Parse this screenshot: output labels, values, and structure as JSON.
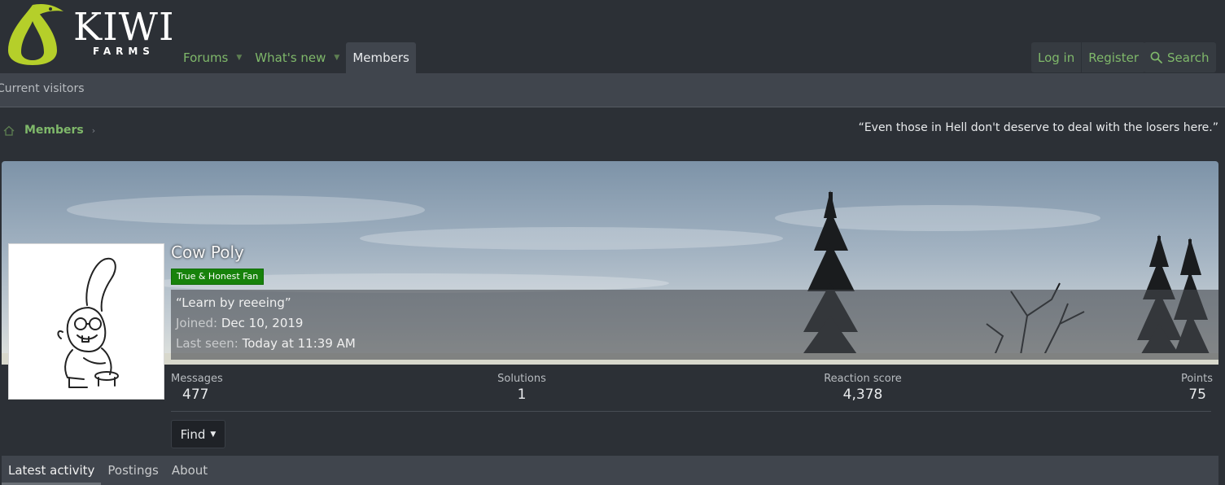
{
  "header": {
    "logo": {
      "word": "KIWI",
      "sub": "FARMS"
    },
    "nav": [
      {
        "label": "Forums",
        "has_menu": true
      },
      {
        "label": "What's new",
        "has_menu": true
      },
      {
        "label": "Members",
        "has_menu": false,
        "active": true
      }
    ],
    "account": {
      "login": "Log in",
      "register": "Register",
      "search": "Search"
    }
  },
  "subnav": {
    "current_visitors": "Current visitors"
  },
  "breadcrumb": {
    "members": "Members"
  },
  "quote": "“Even those in Hell don't deserve to deal with the losers here.”",
  "profile": {
    "name": "Cow Poly",
    "badge": "True & Honest Fan",
    "status": "“Learn by reeeing”",
    "joined_label": "Joined:",
    "joined_value": "Dec 10, 2019",
    "last_seen_label": "Last seen:",
    "last_seen_value": "Today at 11:39 AM",
    "stats": {
      "messages": {
        "label": "Messages",
        "value": "477"
      },
      "solutions": {
        "label": "Solutions",
        "value": "1"
      },
      "reaction": {
        "label": "Reaction score",
        "value": "4,378"
      },
      "points": {
        "label": "Points",
        "value": "75"
      }
    },
    "find_label": "Find",
    "tabs": [
      {
        "label": "Latest activity",
        "active": true
      },
      {
        "label": "Postings"
      },
      {
        "label": "About"
      }
    ]
  },
  "colors": {
    "accent_green": "#7fb86a",
    "badge_green": "#17820b",
    "logo_lime": "#b5cf2a"
  }
}
